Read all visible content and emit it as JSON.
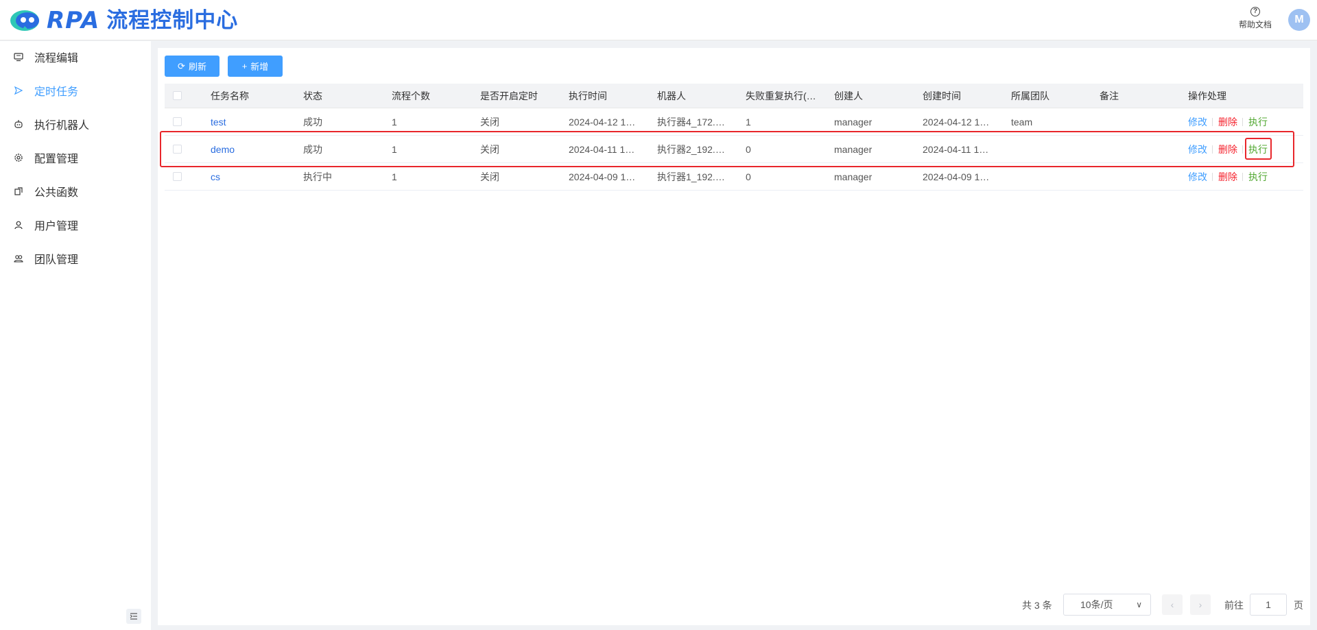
{
  "header": {
    "logo_text": "RPA",
    "title": "流程控制中心",
    "help_label": "帮助文档",
    "help_icon": "question-circle-icon",
    "avatar_letter": "M"
  },
  "sidebar": {
    "items": [
      {
        "label": "流程编辑",
        "icon": "monitor-icon"
      },
      {
        "label": "定时任务",
        "icon": "send-icon",
        "active": true
      },
      {
        "label": "执行机器人",
        "icon": "robot-icon"
      },
      {
        "label": "配置管理",
        "icon": "gear-icon"
      },
      {
        "label": "公共函数",
        "icon": "function-icon"
      },
      {
        "label": "用户管理",
        "icon": "user-icon"
      },
      {
        "label": "团队管理",
        "icon": "team-icon"
      }
    ],
    "collapse_icon": "collapse-menu-icon"
  },
  "toolbar": {
    "refresh_label": "刷新",
    "add_label": "新增"
  },
  "table": {
    "columns": [
      "任务名称",
      "状态",
      "流程个数",
      "是否开启定时",
      "执行时间",
      "机器人",
      "失败重复执行(…",
      "创建人",
      "创建时间",
      "所属团队",
      "备注",
      "操作处理"
    ],
    "rows": [
      {
        "name": "test",
        "status": "成功",
        "count": "1",
        "timer": "关闭",
        "exec_time": "2024-04-12 1…",
        "robot": "执行器4_172.…",
        "retry": "1",
        "creator": "manager",
        "created": "2024-04-12 1…",
        "team": "team",
        "note": ""
      },
      {
        "name": "demo",
        "status": "成功",
        "count": "1",
        "timer": "关闭",
        "exec_time": "2024-04-11 1…",
        "robot": "执行器2_192.…",
        "retry": "0",
        "creator": "manager",
        "created": "2024-04-11 1…",
        "team": "",
        "note": ""
      },
      {
        "name": "cs",
        "status": "执行中",
        "count": "1",
        "timer": "关闭",
        "exec_time": "2024-04-09 1…",
        "robot": "执行器1_192.…",
        "retry": "0",
        "creator": "manager",
        "created": "2024-04-09 1…",
        "team": "",
        "note": ""
      }
    ],
    "actions": {
      "edit": "修改",
      "delete": "删除",
      "run": "执行"
    }
  },
  "pagination": {
    "total": "共 3 条",
    "page_size": "10条/页",
    "goto_label": "前往",
    "current_page": "1",
    "page_suffix": "页"
  }
}
